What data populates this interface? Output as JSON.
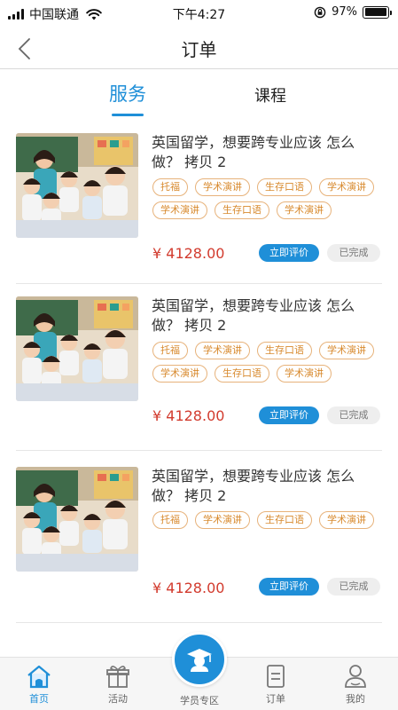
{
  "status_bar": {
    "carrier": "中国联通",
    "time": "下午4:27",
    "battery": "97%",
    "battery_level": 0.97
  },
  "header": {
    "title": "订单",
    "back_icon": "chevron-left-icon"
  },
  "tabs": [
    {
      "label": "服务",
      "active": true
    },
    {
      "label": "课程",
      "active": false
    }
  ],
  "orders": [
    {
      "title": "英国留学，想要跨专业应该 怎么做？ 拷贝 2",
      "tags": [
        "托福",
        "学术演讲",
        "生存口语",
        "学术演讲",
        "学术演讲",
        "生存口语",
        "学术演讲"
      ],
      "price": "¥ 4128.00",
      "action": "立即评价",
      "status": "已完成"
    },
    {
      "title": "英国留学，想要跨专业应该 怎么做？ 拷贝 2",
      "tags": [
        "托福",
        "学术演讲",
        "生存口语",
        "学术演讲",
        "学术演讲",
        "生存口语",
        "学术演讲"
      ],
      "price": "¥ 4128.00",
      "action": "立即评价",
      "status": "已完成"
    },
    {
      "title": "英国留学，想要跨专业应该 怎么做？ 拷贝 2",
      "tags": [
        "托福",
        "学术演讲",
        "生存口语",
        "学术演讲"
      ],
      "price": "¥ 4128.00",
      "action": "立即评价",
      "status": "已完成"
    }
  ],
  "tab_bar": {
    "items": [
      {
        "label": "首页",
        "icon": "home-icon",
        "active": true
      },
      {
        "label": "活动",
        "icon": "gift-icon",
        "active": false
      },
      {
        "label": "学员专区",
        "icon": "graduate-icon",
        "active": false
      },
      {
        "label": "订单",
        "icon": "order-list-icon",
        "active": false
      },
      {
        "label": "我的",
        "icon": "user-icon",
        "active": false
      }
    ]
  },
  "colors": {
    "accent": "#1f8fd8",
    "price": "#d23b2e",
    "tag": "#d88a2e"
  }
}
